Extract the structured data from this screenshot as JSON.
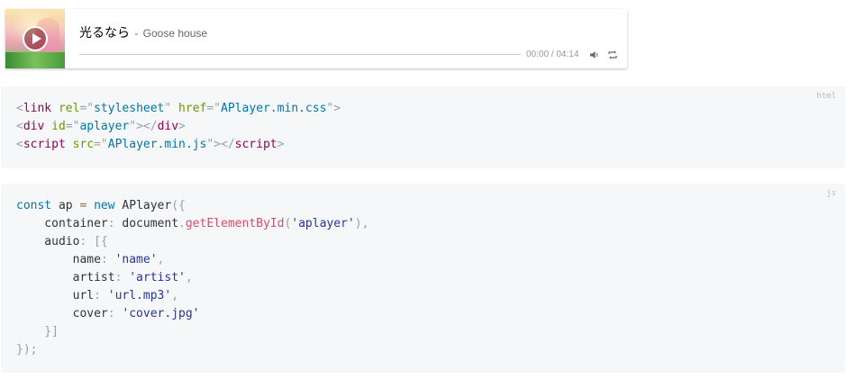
{
  "player": {
    "title": "光るなら",
    "artist_prefix": " - ",
    "artist": "Goose house",
    "time_current": "00:00",
    "time_separator": " / ",
    "time_total": "04:14",
    "progress_fraction": 0,
    "icons": {
      "play": "play-icon",
      "volume": "volume-icon",
      "loop": "loop-icon"
    }
  },
  "html_code": {
    "lang": "html",
    "lines": [
      [
        {
          "t": "<",
          "c": "punc"
        },
        {
          "t": "link",
          "c": "tag"
        },
        {
          "t": " ",
          "c": "plain"
        },
        {
          "t": "rel",
          "c": "attr"
        },
        {
          "t": "=\"",
          "c": "punc"
        },
        {
          "t": "stylesheet",
          "c": "str"
        },
        {
          "t": "\"",
          "c": "punc"
        },
        {
          "t": " ",
          "c": "plain"
        },
        {
          "t": "href",
          "c": "attr"
        },
        {
          "t": "=\"",
          "c": "punc"
        },
        {
          "t": "APlayer.min.css",
          "c": "str"
        },
        {
          "t": "\"",
          "c": "punc"
        },
        {
          "t": ">",
          "c": "punc"
        }
      ],
      [
        {
          "t": "<",
          "c": "punc"
        },
        {
          "t": "div",
          "c": "tag"
        },
        {
          "t": " ",
          "c": "plain"
        },
        {
          "t": "id",
          "c": "attr"
        },
        {
          "t": "=\"",
          "c": "punc"
        },
        {
          "t": "aplayer",
          "c": "str"
        },
        {
          "t": "\"",
          "c": "punc"
        },
        {
          "t": "></",
          "c": "punc"
        },
        {
          "t": "div",
          "c": "tag"
        },
        {
          "t": ">",
          "c": "punc"
        }
      ],
      [
        {
          "t": "<",
          "c": "punc"
        },
        {
          "t": "script",
          "c": "tag"
        },
        {
          "t": " ",
          "c": "plain"
        },
        {
          "t": "src",
          "c": "attr"
        },
        {
          "t": "=\"",
          "c": "punc"
        },
        {
          "t": "APlayer.min.js",
          "c": "str"
        },
        {
          "t": "\"",
          "c": "punc"
        },
        {
          "t": "></",
          "c": "punc"
        },
        {
          "t": "script",
          "c": "tag"
        },
        {
          "t": ">",
          "c": "punc"
        }
      ]
    ]
  },
  "js_code": {
    "lang": "js",
    "lines": [
      [
        {
          "t": "const",
          "c": "kw"
        },
        {
          "t": " ap ",
          "c": "plain"
        },
        {
          "t": "=",
          "c": "op"
        },
        {
          "t": " ",
          "c": "plain"
        },
        {
          "t": "new",
          "c": "kw"
        },
        {
          "t": " APlayer",
          "c": "plain"
        },
        {
          "t": "({",
          "c": "punc"
        }
      ],
      [
        {
          "t": "    container",
          "c": "plain"
        },
        {
          "t": ":",
          "c": "punc"
        },
        {
          "t": " document",
          "c": "plain"
        },
        {
          "t": ".",
          "c": "punc"
        },
        {
          "t": "getElementById",
          "c": "fn"
        },
        {
          "t": "(",
          "c": "punc"
        },
        {
          "t": "'aplayer'",
          "c": "jsstr"
        },
        {
          "t": "),",
          "c": "punc"
        }
      ],
      [
        {
          "t": "    audio",
          "c": "plain"
        },
        {
          "t": ":",
          "c": "punc"
        },
        {
          "t": " [{",
          "c": "punc"
        }
      ],
      [
        {
          "t": "        name",
          "c": "plain"
        },
        {
          "t": ":",
          "c": "punc"
        },
        {
          "t": " ",
          "c": "plain"
        },
        {
          "t": "'name'",
          "c": "jsstr"
        },
        {
          "t": ",",
          "c": "punc"
        }
      ],
      [
        {
          "t": "        artist",
          "c": "plain"
        },
        {
          "t": ":",
          "c": "punc"
        },
        {
          "t": " ",
          "c": "plain"
        },
        {
          "t": "'artist'",
          "c": "jsstr"
        },
        {
          "t": ",",
          "c": "punc"
        }
      ],
      [
        {
          "t": "        url",
          "c": "plain"
        },
        {
          "t": ":",
          "c": "punc"
        },
        {
          "t": " ",
          "c": "plain"
        },
        {
          "t": "'url.mp3'",
          "c": "jsstr"
        },
        {
          "t": ",",
          "c": "punc"
        }
      ],
      [
        {
          "t": "        cover",
          "c": "plain"
        },
        {
          "t": ":",
          "c": "punc"
        },
        {
          "t": " ",
          "c": "plain"
        },
        {
          "t": "'cover.jpg'",
          "c": "jsstr"
        }
      ],
      [
        {
          "t": "    }]",
          "c": "punc"
        }
      ],
      [
        {
          "t": "});",
          "c": "punc"
        }
      ]
    ]
  },
  "colors": {
    "code_bg": "#f6f7f8",
    "tag": "#990055",
    "attr": "#669900",
    "attr_value": "#0077aa",
    "keyword": "#0077aa",
    "function": "#dd4a68",
    "js_string": "#283593",
    "punctuation": "#9aa0a6"
  }
}
